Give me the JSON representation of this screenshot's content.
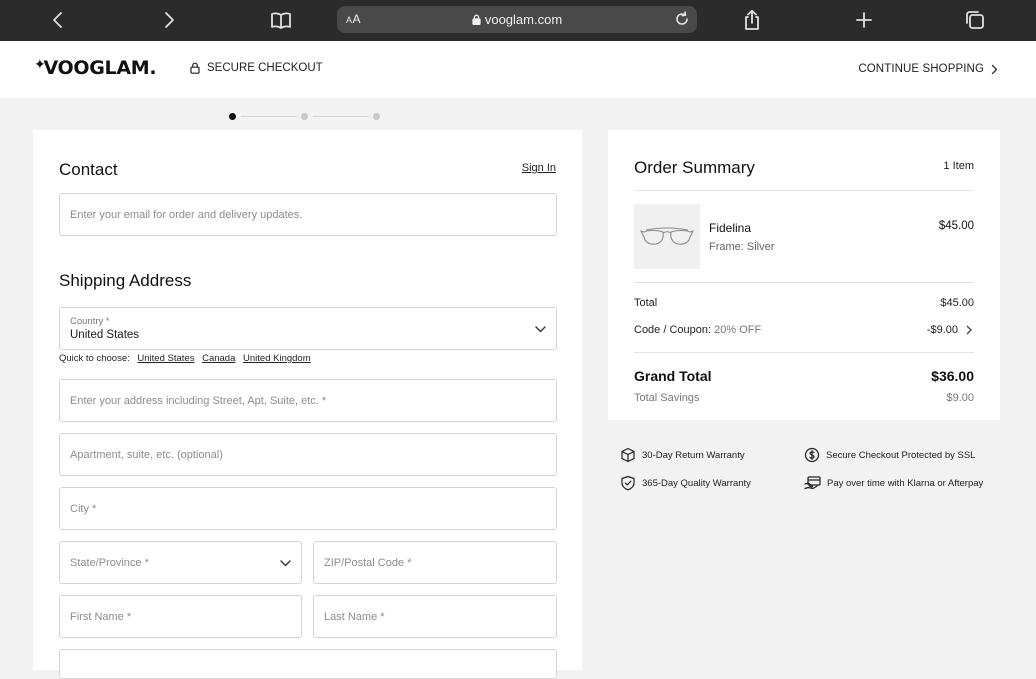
{
  "browser": {
    "text_size_label": "AA",
    "url": "vooglam.com"
  },
  "header": {
    "logo": "VOOGLAM.",
    "secure_label": "SECURE CHECKOUT",
    "continue_label": "CONTINUE SHOPPING"
  },
  "stepper": {
    "current_step": 1,
    "total_steps": 3
  },
  "contact": {
    "title": "Contact",
    "sign_in": "Sign In",
    "email_placeholder": "Enter your email for order and delivery updates."
  },
  "shipping": {
    "title": "Shipping Address",
    "country_label": "Country *",
    "country_value": "United States",
    "quick_label": "Quick to choose:",
    "quick_options": [
      "United States",
      "Canada",
      "United Kingdom"
    ],
    "address_placeholder": "Enter your address including Street, Apt, Suite, etc. *",
    "apartment_placeholder": "Apartment, suite, etc. (optional)",
    "city_placeholder": "City *",
    "state_placeholder": "State/Province *",
    "zip_placeholder": "ZIP/Postal Code *",
    "first_name_placeholder": "First Name *",
    "last_name_placeholder": "Last Name *"
  },
  "summary": {
    "title": "Order Summary",
    "item_count": "1 Item",
    "product": {
      "name": "Fidelina",
      "frame": "Frame: Silver",
      "price": "$45.00"
    },
    "total_label": "Total",
    "total_value": "$45.00",
    "coupon_label": "Code / Coupon:",
    "coupon_code": "20% OFF",
    "coupon_value": "-$9.00",
    "grand_total_label": "Grand Total",
    "grand_total_value": "$36.00",
    "savings_label": "Total Savings",
    "savings_value": "$9.00"
  },
  "badges": [
    {
      "icon": "return-box-icon",
      "text": "30-Day Return Warranty"
    },
    {
      "icon": "dollar-circle-icon",
      "text": "Secure Checkout Protected by SSL"
    },
    {
      "icon": "shield-check-icon",
      "text": "365-Day Quality Warranty"
    },
    {
      "icon": "card-pay-icon",
      "text": "Pay over time with Klarna or Afterpay"
    }
  ]
}
